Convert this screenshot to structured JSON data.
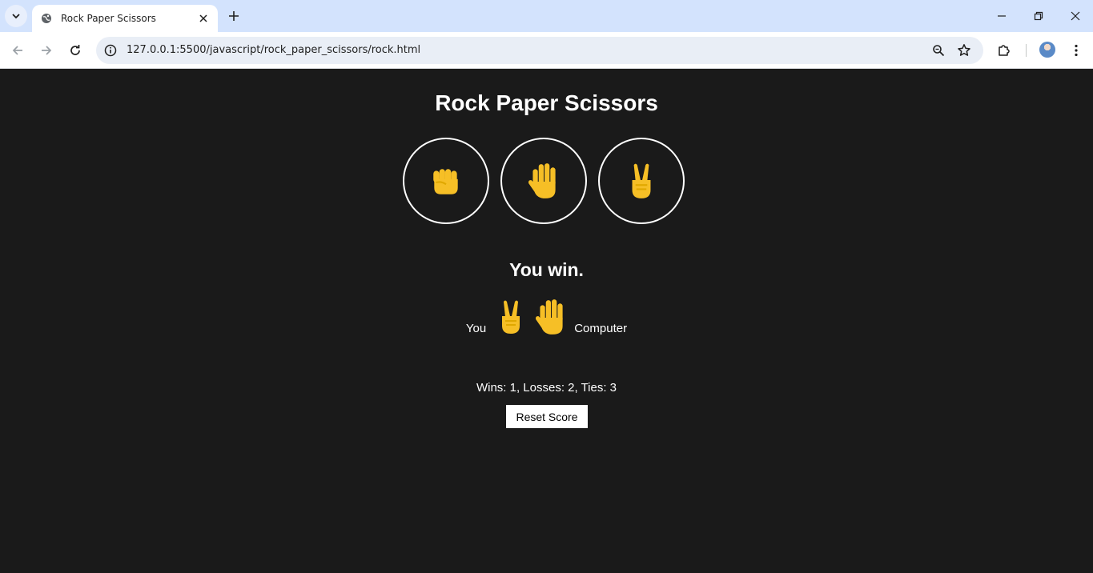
{
  "browser": {
    "tab_title": "Rock Paper Scissors",
    "url": "127.0.0.1:5500/javascript/rock_paper_scissors/rock.html"
  },
  "icons": {
    "favicon": "globe-icon",
    "tab_search": "chevron-down-icon",
    "tab_close": "close-icon",
    "new_tab": "plus-icon",
    "back": "arrow-left-icon",
    "forward": "arrow-right-icon",
    "reload": "reload-icon",
    "site_info": "info-icon",
    "zoom": "zoom-icon",
    "bookmark": "star-icon",
    "extensions": "puzzle-icon",
    "menu": "kebab-menu-icon"
  },
  "game": {
    "title": "Rock Paper Scissors",
    "moves": [
      {
        "name": "rock",
        "glyph": "✊"
      },
      {
        "name": "paper",
        "glyph": "🖐"
      },
      {
        "name": "scissors",
        "glyph": "✌"
      }
    ],
    "result_text": "You win.",
    "you_label": "You",
    "you_move": "scissors",
    "computer_move": "paper",
    "computer_label": "Computer",
    "score_text": "Wins: 1, Losses: 2, Ties: 3",
    "reset_label": "Reset Score"
  },
  "colors": {
    "page_bg": "#1a1a1a",
    "text": "#ffffff",
    "emoji": "#f6bf26",
    "chrome_tabbar": "#d3e3fd",
    "omnibox": "#e9eef6"
  }
}
